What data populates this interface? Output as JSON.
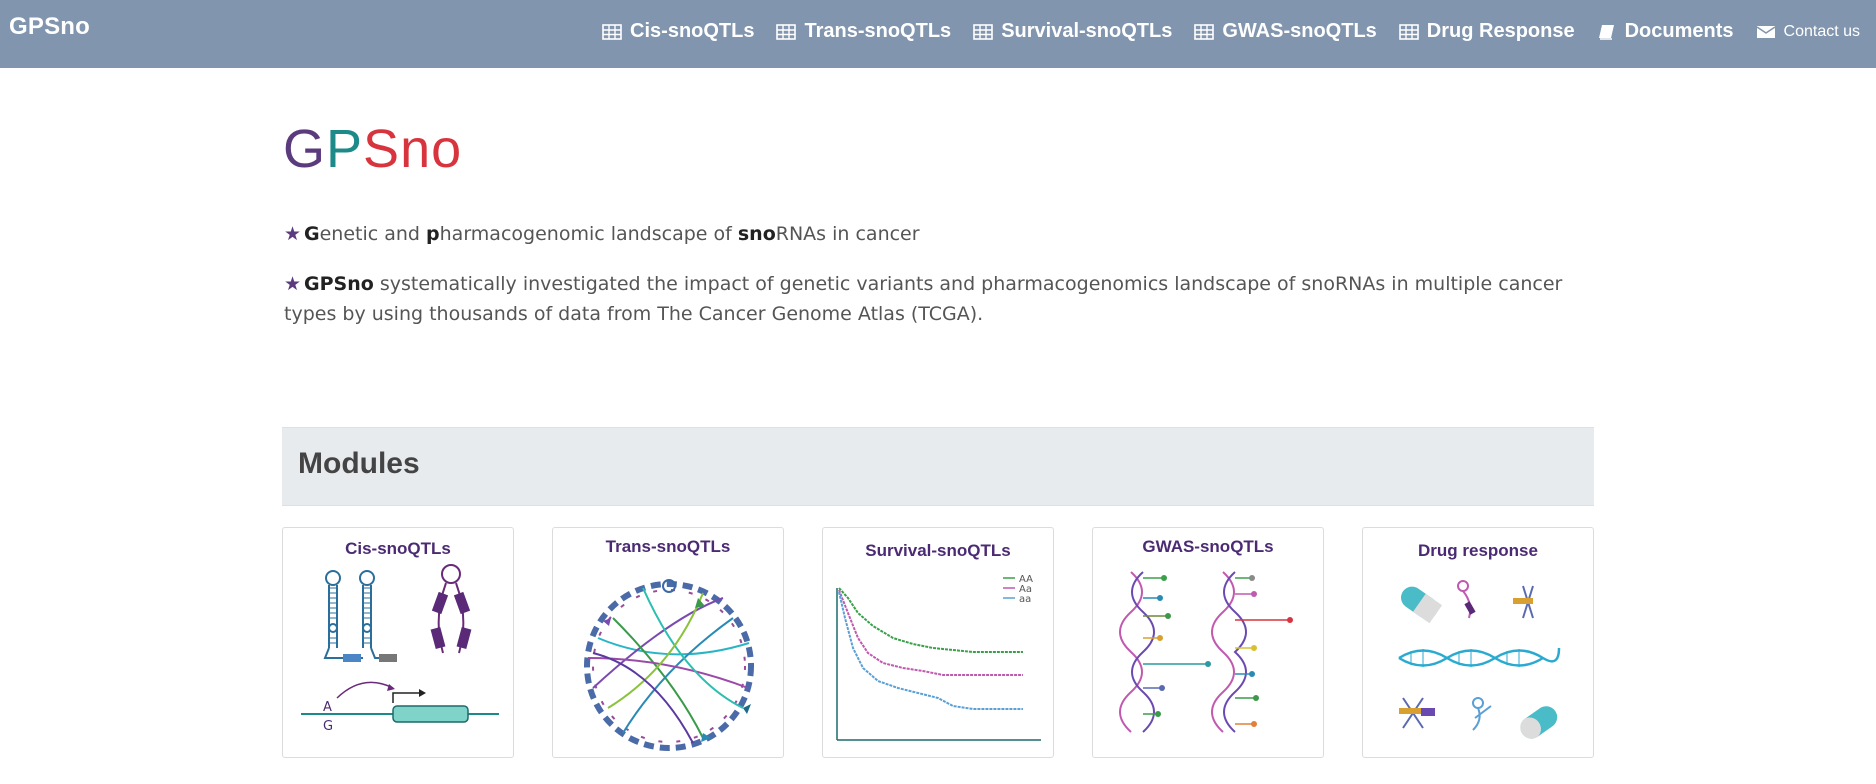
{
  "navbar": {
    "brand": "GPSno",
    "items": [
      {
        "label": "Cis-snoQTLs",
        "icon": "table-icon"
      },
      {
        "label": "Trans-snoQTLs",
        "icon": "table-icon"
      },
      {
        "label": "Survival-snoQTLs",
        "icon": "table-icon"
      },
      {
        "label": "GWAS-snoQTLs",
        "icon": "table-icon"
      },
      {
        "label": "Drug Response",
        "icon": "table-icon"
      },
      {
        "label": "Documents",
        "icon": "book-icon"
      },
      {
        "label": "Contact us",
        "icon": "envelope-icon"
      }
    ]
  },
  "hero": {
    "logo_g": "G",
    "logo_p": "P",
    "logo_s": "Sno",
    "line1": {
      "b1": "G",
      "t1": "enetic and ",
      "b2": "p",
      "t2": "harmacogenomic landscape of ",
      "b3": "sno",
      "t3": "RNAs in cancer"
    },
    "line2": {
      "bold": "GPSno",
      "text": " systematically investigated the impact of genetic variants and pharmacogenomics landscape of snoRNAs in multiple cancer types by using thousands of data from The Cancer Genome Atlas (TCGA)."
    }
  },
  "modules": {
    "heading": "Modules",
    "cards": [
      {
        "title": "Cis-snoQTLs",
        "labels": [
          "A",
          "G"
        ]
      },
      {
        "title": "Trans-snoQTLs"
      },
      {
        "title": "Survival-snoQTLs",
        "legend": [
          "AA",
          "Aa",
          "aa"
        ]
      },
      {
        "title": "GWAS-snoQTLs"
      },
      {
        "title": "Drug response"
      }
    ]
  },
  "colors": {
    "navbar": "#8195ae",
    "purple": "#5b3a7e",
    "teal": "#1d8a8a",
    "red": "#d8343e",
    "modules_bg": "#e8ebee"
  }
}
